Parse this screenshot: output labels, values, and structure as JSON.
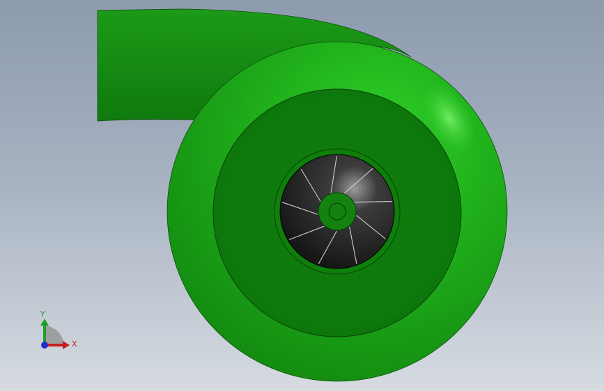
{
  "model": {
    "name": "centrifugal-blower",
    "body_color": "#1fa31a",
    "impeller_color": "#1a1a1a",
    "blade_count": 9
  },
  "triad": {
    "x_label": "X",
    "y_label": "Y",
    "x_color": "#c81e1e",
    "y_color": "#1e9e2a",
    "z_color": "#1e2fc8"
  }
}
